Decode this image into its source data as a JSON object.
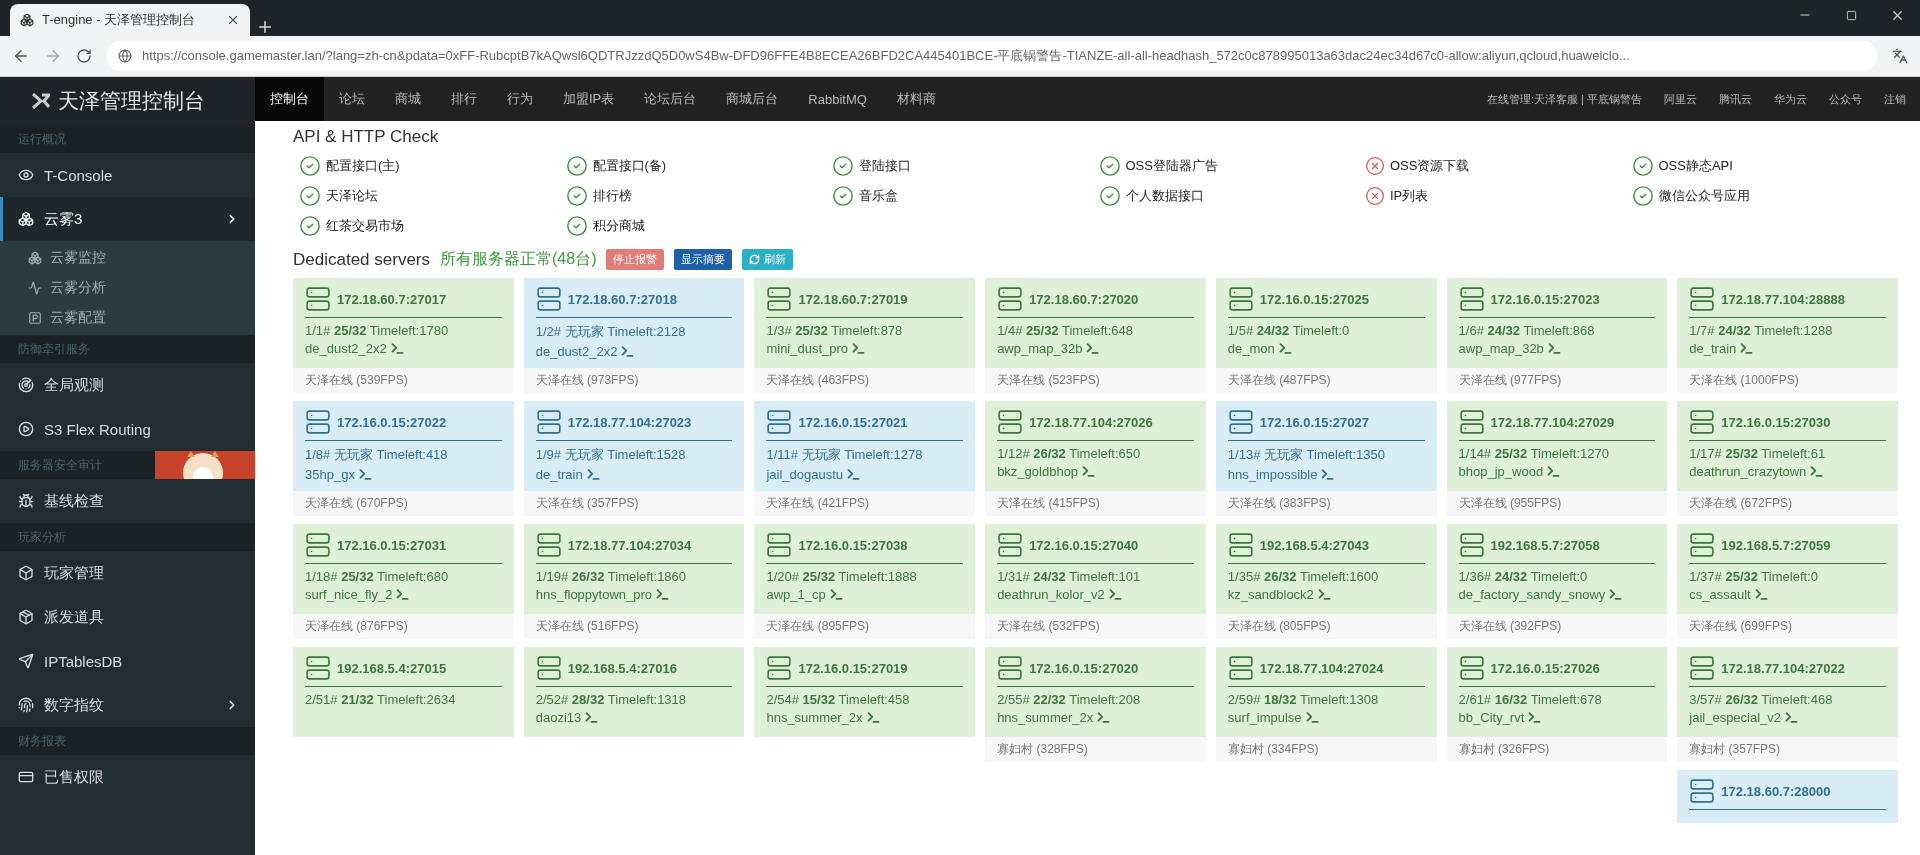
{
  "browser": {
    "tab_title": "T-engine - 天泽管理控制台",
    "url": "https://console.gamemaster.lan/?lang=zh-cn&pdata=0xFF-RubcptB7kAQwsl6QDTRJzzdQ5D0wS4Bw-DFD96FFE4B8ECEA26BFD2CA445401BCE-平底锅警告-TIANZE-all-all-headhash_572c0c878995013a63dac24ec34d67c0-allow:aliyun,qcloud,huaweiclo..."
  },
  "sidebar": {
    "brand": "天泽管理控制台",
    "sections": [
      {
        "title": "运行概况",
        "items": [
          {
            "label": "T-Console",
            "selected": false,
            "submenu": false
          }
        ]
      },
      {
        "items": [
          {
            "label": "云雾3",
            "selected": true,
            "submenu": true,
            "expanded": true,
            "children": [
              {
                "label": "云雾监控"
              },
              {
                "label": "云雾分析"
              },
              {
                "label": "云雾配置"
              }
            ]
          }
        ]
      },
      {
        "title": "防御牵引服务",
        "items": [
          {
            "label": "全局观测",
            "selected": false,
            "submenu": false
          },
          {
            "label": "S3 Flex Routing",
            "selected": false,
            "submenu": false
          }
        ]
      },
      {
        "title": "服务器安全审计",
        "items": [
          {
            "label": "基线检查",
            "selected": false,
            "submenu": false
          }
        ]
      },
      {
        "title": "玩家分析",
        "items": [
          {
            "label": "玩家管理",
            "selected": false,
            "submenu": false
          },
          {
            "label": "派发道具",
            "selected": false,
            "submenu": false
          },
          {
            "label": "IPTablesDB",
            "selected": false,
            "submenu": false
          },
          {
            "label": "数字指纹",
            "selected": false,
            "submenu": true
          }
        ]
      },
      {
        "title": "财务报表",
        "items": [
          {
            "label": "已售权限",
            "selected": false,
            "submenu": false
          }
        ]
      }
    ]
  },
  "topnav": {
    "tabs": [
      {
        "label": "控制台",
        "selected": true
      },
      {
        "label": "论坛",
        "selected": false
      },
      {
        "label": "商城",
        "selected": false
      },
      {
        "label": "排行",
        "selected": false
      },
      {
        "label": "行为",
        "selected": false
      },
      {
        "label": "加盟IP表",
        "selected": false
      },
      {
        "label": "论坛后台",
        "selected": false
      },
      {
        "label": "商城后台",
        "selected": false
      },
      {
        "label": "RabbitMQ",
        "selected": false
      },
      {
        "label": "材料商",
        "selected": false
      }
    ],
    "links": [
      "在线管理:天泽客服 | 平底锅警告",
      "阿里云",
      "腾讯云",
      "华为云",
      "公众号",
      "注销"
    ]
  },
  "api_check": {
    "title": "API & HTTP Check",
    "columns": [
      [
        {
          "label": "配置接口(主)",
          "ok": true
        },
        {
          "label": "天泽论坛",
          "ok": true
        },
        {
          "label": "红茶交易市场",
          "ok": true
        }
      ],
      [
        {
          "label": "配置接口(备)",
          "ok": true
        },
        {
          "label": "排行榜",
          "ok": true
        },
        {
          "label": "积分商城",
          "ok": true
        }
      ],
      [
        {
          "label": "登陆接口",
          "ok": true
        },
        {
          "label": "音乐盒",
          "ok": true
        }
      ],
      [
        {
          "label": "OSS登陆器广告",
          "ok": true
        },
        {
          "label": "个人数据接口",
          "ok": true
        }
      ],
      [
        {
          "label": "OSS资源下载",
          "ok": false
        },
        {
          "label": "IP列表",
          "ok": false
        }
      ],
      [
        {
          "label": "OSS静态API",
          "ok": true
        },
        {
          "label": "微信公众号应用",
          "ok": true
        }
      ]
    ]
  },
  "servers": {
    "title": "Dedicated servers",
    "status": "所有服务器正常(48台)",
    "buttons": [
      {
        "label": "停止报警",
        "kind": "danger"
      },
      {
        "label": "显示摘要",
        "kind": "primary"
      },
      {
        "label": "刷新",
        "kind": "refresh"
      }
    ],
    "columns": [
      [
        {
          "address": "172.18.60.7:27017",
          "kind": "active",
          "stats": "1/1# **25/32** Timeleft:1780",
          "map": "de_dust2_2x2",
          "footer": "天泽在线 (539FPS)"
        },
        {
          "address": "172.16.0.15:27022",
          "kind": "idle",
          "stats": "1/8# 无玩家 Timeleft:418",
          "map": "35hp_gx",
          "footer": "天泽在线 (670FPS)"
        },
        {
          "address": "172.16.0.15:27031",
          "kind": "active",
          "stats": "1/18# **25/32** Timeleft:680",
          "map": "surf_nice_fly_2",
          "footer": "天泽在线 (876FPS)"
        },
        {
          "address": "192.168.5.4:27015",
          "kind": "active",
          "stats": "2/51# **21/32** Timeleft:2634"
        }
      ],
      [
        {
          "address": "172.18.60.7:27018",
          "kind": "idle",
          "stats": "1/2# 无玩家 Timeleft:2128",
          "map": "de_dust2_2x2",
          "footer": "天泽在线 (973FPS)"
        },
        {
          "address": "172.18.77.104:27023",
          "kind": "idle",
          "stats": "1/9# 无玩家 Timeleft:1528",
          "map": "de_train",
          "footer": "天泽在线 (357FPS)"
        },
        {
          "address": "172.18.77.104:27034",
          "kind": "active",
          "stats": "1/19# **26/32** Timeleft:1860",
          "map": "hns_floppytown_pro",
          "footer": "天泽在线 (516FPS)"
        },
        {
          "address": "192.168.5.4:27016",
          "kind": "active",
          "stats": "2/52# **28/32** Timeleft:1318",
          "map": "daozi13"
        }
      ],
      [
        {
          "address": "172.18.60.7:27019",
          "kind": "active",
          "stats": "1/3# **25/32** Timeleft:878",
          "map": "mini_dust_pro",
          "footer": "天泽在线 (463FPS)"
        },
        {
          "address": "172.16.0.15:27021",
          "kind": "idle",
          "stats": "1/11# 无玩家 Timeleft:1278",
          "map": "jail_dogaustu",
          "footer": "天泽在线 (421FPS)"
        },
        {
          "address": "172.16.0.15:27038",
          "kind": "active",
          "stats": "1/20# **25/32** Timeleft:1888",
          "map": "awp_1_cp",
          "footer": "天泽在线 (895FPS)"
        },
        {
          "address": "172.16.0.15:27019",
          "kind": "active",
          "stats": "2/54# **15/32** Timeleft:458",
          "map": "hns_summer_2x"
        }
      ],
      [
        {
          "address": "172.18.60.7:27020",
          "kind": "active",
          "stats": "1/4# **25/32** Timeleft:648",
          "map": "awp_map_32b",
          "footer": "天泽在线 (523FPS)"
        },
        {
          "address": "172.18.77.104:27026",
          "kind": "active",
          "stats": "1/12# **26/32** Timeleft:650",
          "map": "bkz_goldbhop",
          "footer": "天泽在线 (415FPS)"
        },
        {
          "address": "172.16.0.15:27040",
          "kind": "active",
          "stats": "1/31# **24/32** Timeleft:101",
          "map": "deathrun_kolor_v2",
          "footer": "天泽在线 (532FPS)"
        },
        {
          "address": "172.16.0.15:27020",
          "kind": "active",
          "stats": "2/55# **22/32** Timeleft:208",
          "map": "hns_summer_2x",
          "footer": "寡妇村 (328FPS)"
        }
      ],
      [
        {
          "address": "172.16.0.15:27025",
          "kind": "active",
          "stats": "1/5# **24/32** Timeleft:0",
          "map": "de_mon",
          "footer": "天泽在线 (487FPS)"
        },
        {
          "address": "172.16.0.15:27027",
          "kind": "idle",
          "stats": "1/13# 无玩家 Timeleft:1350",
          "map": "hns_impossible",
          "footer": "天泽在线 (383FPS)"
        },
        {
          "address": "192.168.5.4:27043",
          "kind": "active",
          "stats": "1/35# **26/32** Timeleft:1600",
          "map": "kz_sandblock2",
          "footer": "天泽在线 (805FPS)"
        },
        {
          "address": "172.18.77.104:27024",
          "kind": "active",
          "stats": "2/59# **18/32** Timeleft:1308",
          "map": "surf_impulse",
          "footer": "寡妇村 (334FPS)"
        }
      ],
      [
        {
          "address": "172.16.0.15:27023",
          "kind": "active",
          "stats": "1/6# **24/32** Timeleft:868",
          "map": "awp_map_32b",
          "footer": "天泽在线 (977FPS)"
        },
        {
          "address": "172.18.77.104:27029",
          "kind": "active",
          "stats": "1/14# **25/32** Timeleft:1270",
          "map": "bhop_jp_wood",
          "footer": "天泽在线 (955FPS)"
        },
        {
          "address": "192.168.5.7:27058",
          "kind": "active",
          "stats": "1/36# **24/32** Timeleft:0",
          "map": "de_factory_sandy_snowy",
          "footer": "天泽在线 (392FPS)"
        },
        {
          "address": "172.16.0.15:27026",
          "kind": "active",
          "stats": "2/61# **16/32** Timeleft:678",
          "map": "bb_City_rvt",
          "footer": "寡妇村 (326FPS)"
        }
      ],
      [
        {
          "address": "172.18.77.104:28888",
          "kind": "active",
          "stats": "1/7# **24/32** Timeleft:1288",
          "map": "de_train",
          "footer": "天泽在线 (1000FPS)"
        },
        {
          "address": "172.16.0.15:27030",
          "kind": "active",
          "stats": "1/17# **25/32** Timeleft:61",
          "map": "deathrun_crazytown",
          "footer": "天泽在线 (672FPS)"
        },
        {
          "address": "192.168.5.7:27059",
          "kind": "active",
          "stats": "1/37# **25/32** Timeleft:0",
          "map": "cs_assault",
          "footer": "天泽在线 (699FPS)"
        },
        {
          "address": "172.18.77.104:27022",
          "kind": "active",
          "stats": "3/57# **26/32** Timeleft:468",
          "map": "jail_especial_v2",
          "footer": "寡妇村 (357FPS)"
        },
        {
          "address": "172.18.60.7:28000",
          "kind": "idle"
        }
      ]
    ]
  }
}
